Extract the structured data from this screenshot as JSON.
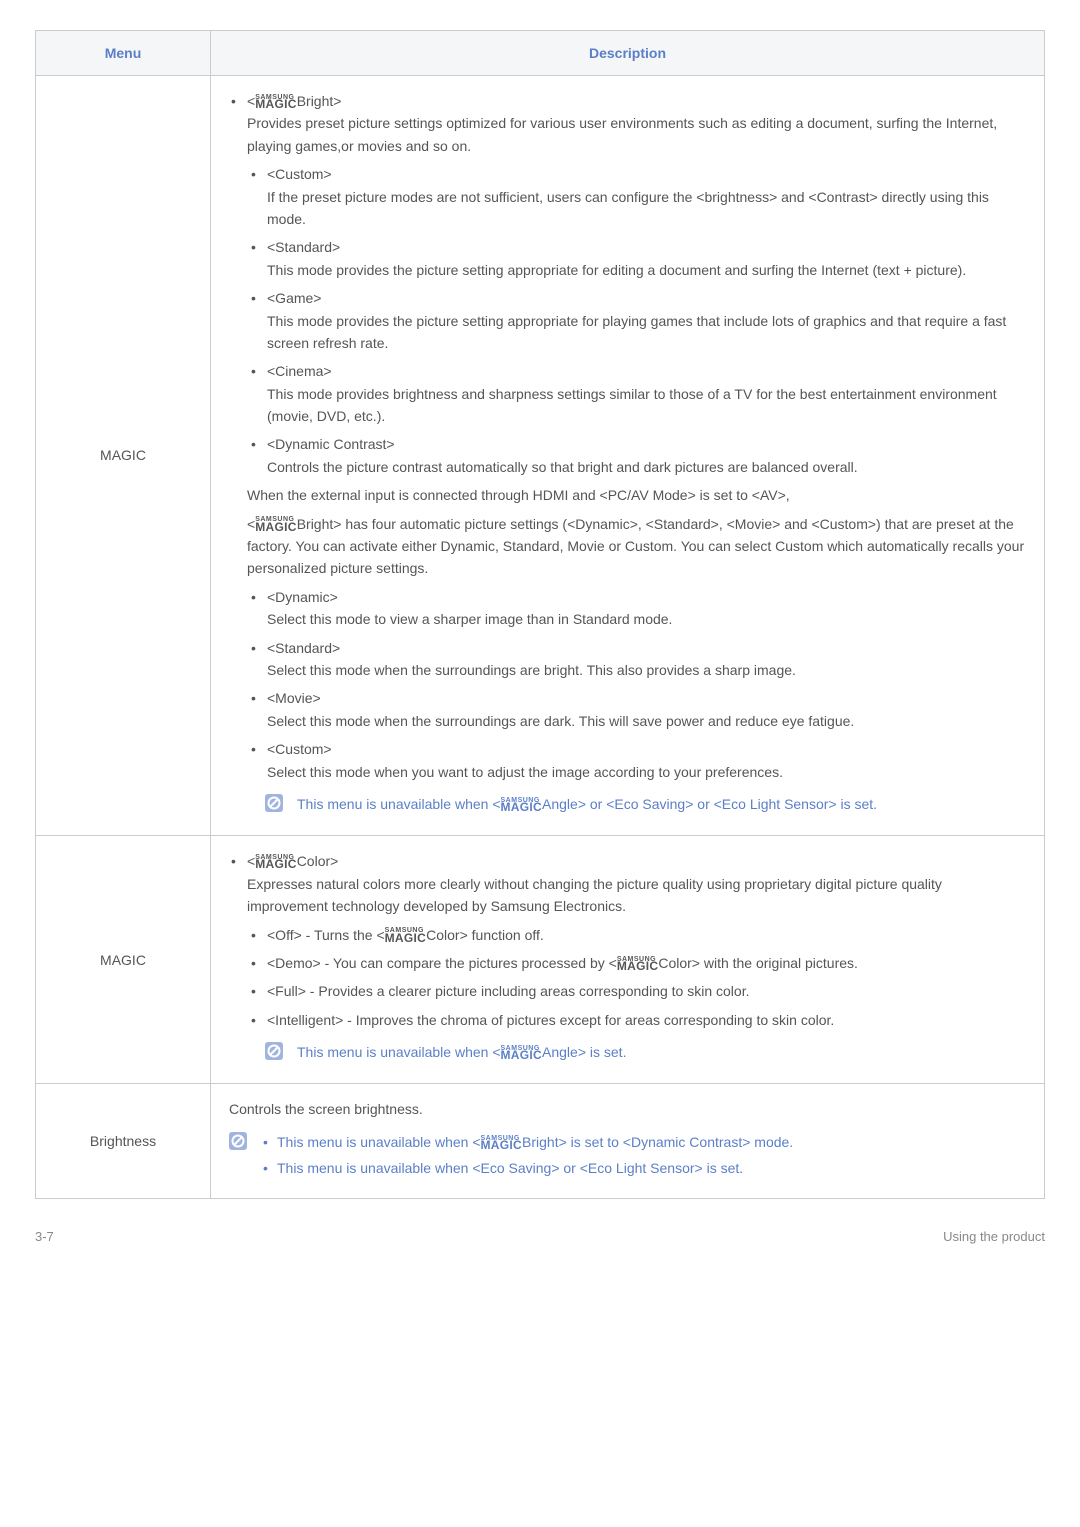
{
  "header": {
    "menu": "Menu",
    "description": "Description"
  },
  "rows": [
    {
      "menu": "MAGIC",
      "bright": {
        "label_suffix": "Bright>",
        "intro": "Provides preset picture settings optimized for various user environments such as editing a document, surfing the Internet, playing games,or movies and so on.",
        "items": [
          {
            "title": "<Custom>",
            "text": "If the preset picture modes are not sufficient, users can configure the <brightness> and <Contrast> directly using this mode."
          },
          {
            "title": "<Standard>",
            "text": " This mode provides the picture setting appropriate for editing a document and surfing the Internet (text + picture)."
          },
          {
            "title": "<Game>",
            "text": "This mode provides the picture setting appropriate for playing games that include lots of graphics and that require a fast screen refresh rate."
          },
          {
            "title": "<Cinema>",
            "text": "This mode provides brightness and sharpness settings similar to those of a TV for the best entertainment environment (movie, DVD, etc.)."
          },
          {
            "title": "<Dynamic Contrast>",
            "text": "Controls the picture contrast automatically so that bright and dark pictures are balanced overall."
          }
        ],
        "hdmi_line": "When the external input is connected through HDMI and <PC/AV Mode> is set to <AV>,",
        "hdmi_bright_prefix": "<",
        "hdmi_bright_suffix": "Bright> has four automatic picture settings (<Dynamic>, <Standard>, <Movie> and <Custom>) that are preset at the factory. You can activate either Dynamic, Standard, Movie or Custom. You can select Custom which automatically recalls your personalized picture settings.",
        "items2": [
          {
            "title": "<Dynamic>",
            "text": "Select this mode to view a sharper image than in Standard mode."
          },
          {
            "title": "<Standard>",
            "text": "Select this mode when the surroundings are bright. This also provides a sharp image."
          },
          {
            "title": "<Movie>",
            "text": "Select this mode when the surroundings are dark. This will save power and reduce eye fatigue."
          },
          {
            "title": "<Custom>",
            "text": "Select this mode when you want to adjust the image according to your preferences."
          }
        ],
        "note_prefix": "This menu is unavailable when <",
        "note_suffix": "Angle> or <Eco Saving> or <Eco Light Sensor> is set."
      }
    },
    {
      "menu": "MAGIC",
      "color": {
        "label_suffix": "Color>",
        "intro": "Expresses natural colors more clearly without changing the picture quality using proprietary digital picture quality improvement technology developed by Samsung Electronics.",
        "items": {
          "off_pre": "<Off> - Turns the <",
          "off_post": "Color> function off.",
          "demo_pre": "<Demo> - You can compare the pictures processed by <",
          "demo_post": "Color> with the original pictures.",
          "full": "<Full> - Provides a clearer picture including areas corresponding to skin color.",
          "intelligent": "<Intelligent> - Improves the chroma of pictures except for areas corresponding to skin color."
        },
        "note_prefix": "This menu is unavailable when <",
        "note_suffix": "Angle> is set."
      }
    },
    {
      "menu": "Brightness",
      "brightness": {
        "intro": "Controls the screen brightness.",
        "note1_pre": "This menu is unavailable when <",
        "note1_post": "Bright> is set to <Dynamic Contrast> mode.",
        "note2": "This menu is unavailable when <Eco Saving> or <Eco Light Sensor> is set."
      }
    }
  ],
  "samsung_magic": {
    "top": "SAMSUNG",
    "bot": "MAGIC"
  },
  "footer": {
    "left": "3-7",
    "right": "Using the product"
  }
}
